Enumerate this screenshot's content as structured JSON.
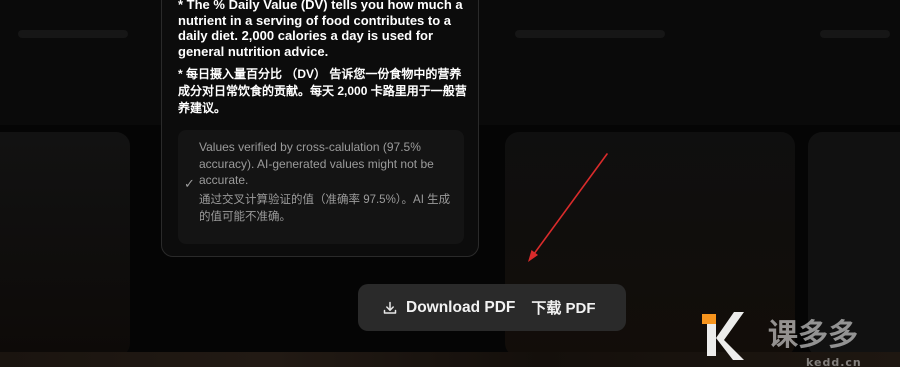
{
  "info_panel": {
    "dv_note_en": "* The % Daily Value (DV) tells you how much a nutrient in a serving of food contributes to a daily diet. 2,000 calories a day is used for general nutrition advice.",
    "dv_note_zh": "* 每日摄入量百分比 （DV） 告诉您一份食物中的营养成分对日常饮食的贡献。每天 2,000 卡路里用于一般营养建议。",
    "verification": {
      "icon": "check-icon",
      "note_en": "Values verified by cross-calulation (97.5% accuracy). AI-generated values might not be accurate.",
      "note_zh": "通过交叉计算验证的值（准确率 97.5%）。AI 生成的值可能不准确。"
    }
  },
  "download_button": {
    "icon": "download-icon",
    "label": "Download PDF",
    "label_zh": "下载 PDF"
  },
  "annotation": {
    "color": "#d92b2b"
  },
  "watermark": {
    "brand_text": "课多多",
    "domain": "kedd.cn",
    "accent": "#f7941d"
  }
}
